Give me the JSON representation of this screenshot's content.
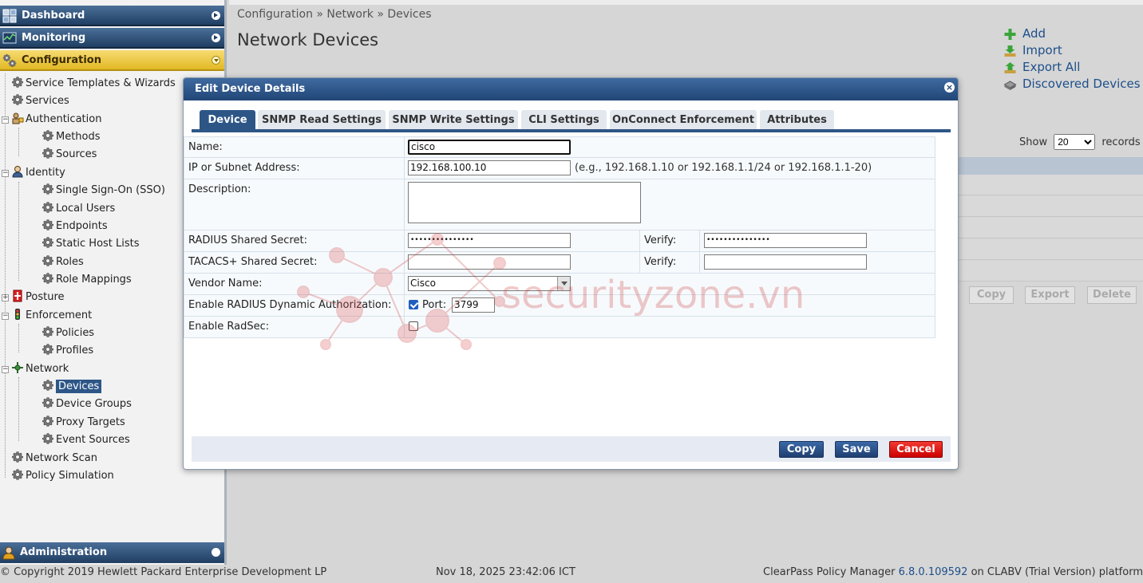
{
  "sidebar": {
    "headers": {
      "dashboard": "Dashboard",
      "monitoring": "Monitoring",
      "configuration": "Configuration",
      "administration": "Administration"
    },
    "tree": [
      {
        "label": "Service Templates & Wizards"
      },
      {
        "label": "Services"
      },
      {
        "label": "Authentication"
      },
      {
        "label": "Methods"
      },
      {
        "label": "Sources"
      },
      {
        "label": "Identity"
      },
      {
        "label": "Single Sign-On (SSO)"
      },
      {
        "label": "Local Users"
      },
      {
        "label": "Endpoints"
      },
      {
        "label": "Static Host Lists"
      },
      {
        "label": "Roles"
      },
      {
        "label": "Role Mappings"
      },
      {
        "label": "Posture"
      },
      {
        "label": "Enforcement"
      },
      {
        "label": "Policies"
      },
      {
        "label": "Profiles"
      },
      {
        "label": "Network"
      },
      {
        "label": "Devices"
      },
      {
        "label": "Device Groups"
      },
      {
        "label": "Proxy Targets"
      },
      {
        "label": "Event Sources"
      },
      {
        "label": "Network Scan"
      },
      {
        "label": "Policy Simulation"
      }
    ]
  },
  "main": {
    "breadcrumb": "Configuration » Network » Devices",
    "title": "Network Devices",
    "actions": {
      "add": "Add",
      "import": "Import",
      "export_all": "Export All",
      "discovered": "Discovered Devices"
    },
    "show_label": "Show",
    "records_value": "20",
    "records_label": "records",
    "bg_buttons": {
      "copy": "Copy",
      "export": "Export",
      "delete": "Delete"
    }
  },
  "modal": {
    "title": "Edit Device Details",
    "tabs": [
      "Device",
      "SNMP Read Settings",
      "SNMP Write Settings",
      "CLI Settings",
      "OnConnect Enforcement",
      "Attributes"
    ],
    "labels": {
      "name": "Name:",
      "ip": "IP or Subnet Address:",
      "description": "Description:",
      "radius_secret": "RADIUS Shared Secret:",
      "tacacs_secret": "TACACS+ Shared Secret:",
      "verify": "Verify:",
      "vendor": "Vendor Name:",
      "radius_dyn": "Enable RADIUS Dynamic Authorization:",
      "port": "Port:",
      "radsec": "Enable RadSec:"
    },
    "values": {
      "name": "cisco",
      "ip": "192.168.100.10",
      "ip_hint": "(e.g., 192.168.1.10 or 192.168.1.1/24 or 192.168.1.1-20)",
      "description": "",
      "radius_secret": "•••••••••••••••",
      "radius_verify": "•••••••••••••••",
      "tacacs_secret": "",
      "tacacs_verify": "",
      "vendor": "Cisco",
      "port": "3799",
      "radius_dyn_enabled": true,
      "radsec_enabled": false
    },
    "buttons": {
      "copy": "Copy",
      "save": "Save",
      "cancel": "Cancel"
    }
  },
  "footer": {
    "copyright": "© Copyright 2019 Hewlett Packard Enterprise Development LP",
    "timestamp": "Nov 18, 2025 23:42:06 ICT",
    "product_prefix": "ClearPass Policy Manager",
    "version": "6.8.0.109592",
    "product_suffix": "on CLABV (Trial Version) platform"
  },
  "watermark": {
    "text": "securityzone.vn"
  },
  "colors": {
    "nav_blue": "#2d5687",
    "config_yellow": "#e2b824",
    "cancel_red": "#cc0000",
    "link_blue": "#1d4f8a"
  }
}
